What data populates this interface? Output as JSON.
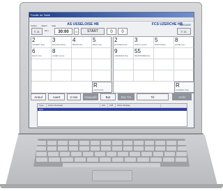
{
  "window": {
    "title": "Feuille de Table"
  },
  "menu": [
    "Fichier",
    "Match",
    "Aide"
  ],
  "match": {
    "home_team": "AS USSELOISE HB",
    "away_team": "FCS UZERCHE HB",
    "date": "08/04/08",
    "home_score": "0",
    "away_score": "0",
    "half": "MI 1",
    "clock": "30:00",
    "start_label": "START",
    "period_marker": "II",
    "home_timeout_label": "T. O.",
    "away_timeout_label": "T. O."
  },
  "home_players": [
    {
      "num": "2",
      "name": "LAURENT Jules"
    },
    {
      "num": "3",
      "name": "MOULIN Anthony"
    },
    {
      "num": "4",
      "name": "BRUNO Alex"
    },
    {
      "num": "5",
      "name": "BRUN Jean"
    },
    {
      "num": "6",
      "name": "MALIS Yann"
    },
    {
      "num": "8",
      "name": "JAGER Jerome"
    }
  ],
  "away_players": [
    {
      "num": "2",
      "name": "BLONDEAU Eric"
    },
    {
      "num": "3",
      "name": "DUPUY Laurent"
    },
    {
      "num": "5",
      "name": "MARTIN Brice"
    },
    {
      "num": "8",
      "name": "FAURE Jean"
    },
    {
      "num": "9",
      "name": "LAMARQUE Paul"
    },
    {
      "num": "55",
      "name": "PRUDHOMME Paul"
    }
  ],
  "reserve": {
    "home_label": "R",
    "home_name": "LOUIS Andre",
    "away_label": "R",
    "away_name": "LAGARDE Julien"
  },
  "actions": [
    "Annul",
    "Avert",
    "2 min",
    "Disqualif",
    "But",
    "But 7m",
    "Tir",
    "Arrêt"
  ],
  "log": {
    "columns": [
      "Type",
      "Action Nouveau",
      "Id A",
      "Id B",
      "Action Replay"
    ],
    "rows": [
      "Deb"
    ]
  },
  "colors": {
    "accent": "#1a3c8a",
    "selection": "#2b3fa6"
  }
}
